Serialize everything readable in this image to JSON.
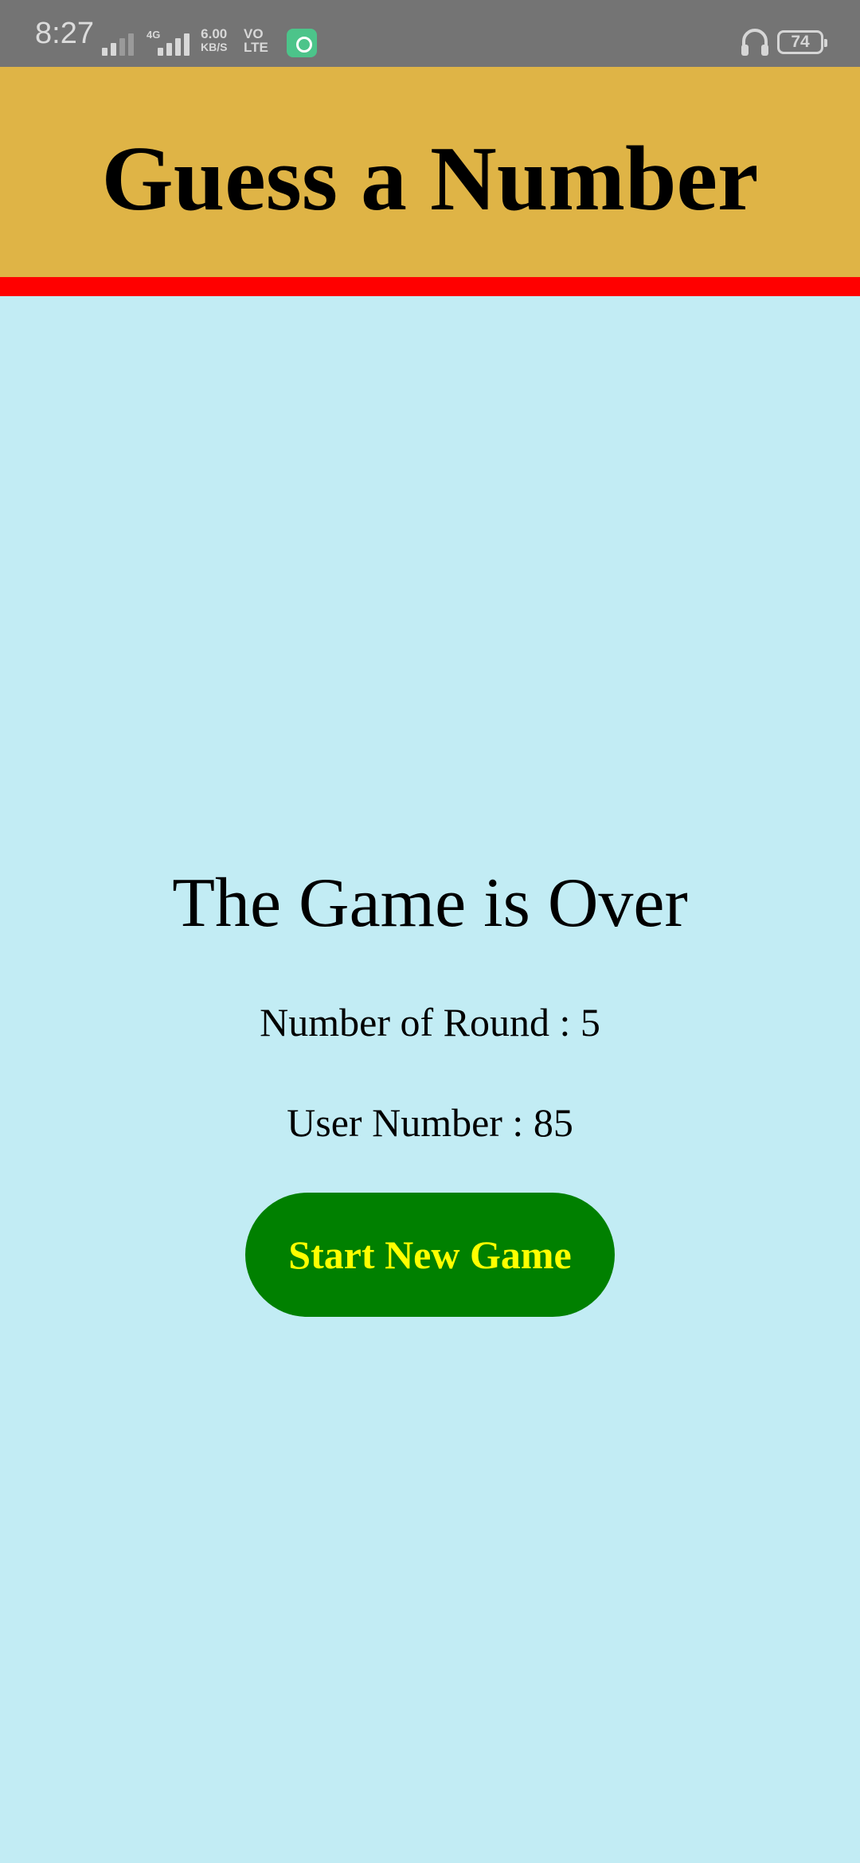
{
  "status_bar": {
    "time": "8:27",
    "network": "4G",
    "speed_value": "6.00",
    "speed_unit": "KB/S",
    "volte_top": "VO",
    "volte_bottom": "LTE",
    "battery": "74"
  },
  "header": {
    "title": "Guess a Number",
    "background_color": "#dfb446",
    "underline_color": "#ff0000"
  },
  "game_over": {
    "title": "The Game is Over",
    "rounds_label": "Number of Round : 5",
    "user_number_label": "User Number : 85",
    "button_label": "Start New Game",
    "button_color": "#008000",
    "button_text_color": "#ffff00"
  },
  "colors": {
    "status_bar": "#747474",
    "page_background": "#c2ecf4"
  }
}
